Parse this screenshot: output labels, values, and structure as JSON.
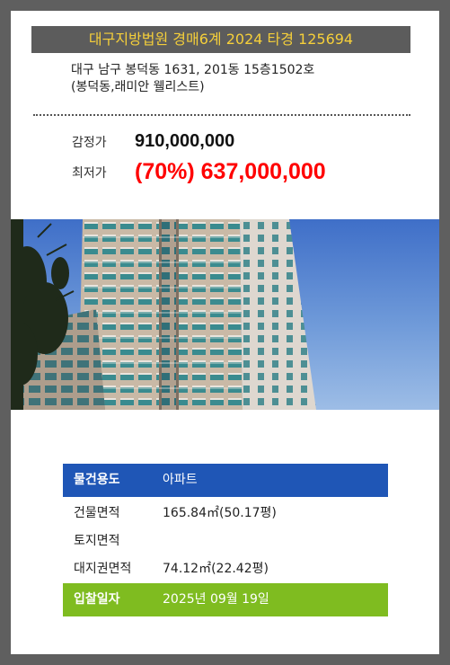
{
  "header": {
    "case_title": "대구지방법원 경매6계 2024 타경 125694"
  },
  "address": {
    "line1": "대구 남구 봉덕동 1631, 201동 15층1502호",
    "line2": "(봉덕동,래미안 웰리스트)"
  },
  "prices": {
    "appraised_label": "감정가",
    "appraised_value": "910,000,000",
    "minimum_label": "최저가",
    "minimum_value": "(70%) 637,000,000"
  },
  "colors": {
    "header_bg": "#5c5c5c",
    "header_text": "#f5cf3a",
    "minimum_price": "#ff0000",
    "usage_row": "#1f56b6",
    "bid_row": "#7fbc20"
  },
  "photo": {
    "icon": "apartment-building-photo"
  },
  "details": {
    "usage_label": "물건용도",
    "usage_value": "아파트",
    "building_area_label": "건물면적",
    "building_area_value": "165.84㎡(50.17평)",
    "land_area_label": "토지면적",
    "land_area_value": "",
    "land_right_area_label": "대지권면적",
    "land_right_area_value": "74.12㎡(22.42평)",
    "bid_date_label": "입찰일자",
    "bid_date_value": "2025년 09월 19일"
  }
}
